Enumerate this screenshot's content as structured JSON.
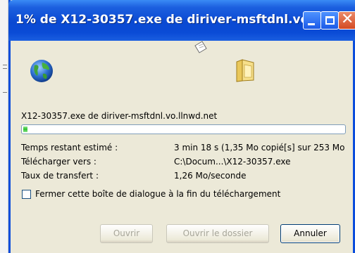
{
  "window": {
    "title": "1% de X12-30357.exe de diriver-msftdnl.vo...",
    "title_buttons": {
      "minimize": "minimize-icon",
      "maximize": "maximize-icon",
      "close": "close-icon"
    }
  },
  "download": {
    "source": "X12-30357.exe de diriver-msftdnl.vo.llnwd.net",
    "progress_percent": 1,
    "rows": [
      {
        "label": "Temps restant estimé :",
        "value": "3 min 18 s (1,35 Mo copié[s] sur 253 Mo"
      },
      {
        "label": "Télécharger vers :",
        "value": "C:\\Docum...\\X12-30357.exe"
      },
      {
        "label": "Taux de transfert :",
        "value": "1,26 Mo/seconde"
      }
    ],
    "close_on_finish": {
      "label": "Fermer cette boîte de dialogue à la fin du téléchargement",
      "checked": false
    }
  },
  "buttons": {
    "open": "Ouvrir",
    "open_folder": "Ouvrir le dossier",
    "cancel": "Annuler"
  },
  "icons": {
    "paper": "flying-document-icon",
    "globe": "globe-icon",
    "folder": "folder-icon"
  },
  "colors": {
    "titlebar": "#0a4bd6",
    "dialog_bg": "#ece9d8",
    "progress": "#2fc12f",
    "close_button": "#d44a22"
  }
}
